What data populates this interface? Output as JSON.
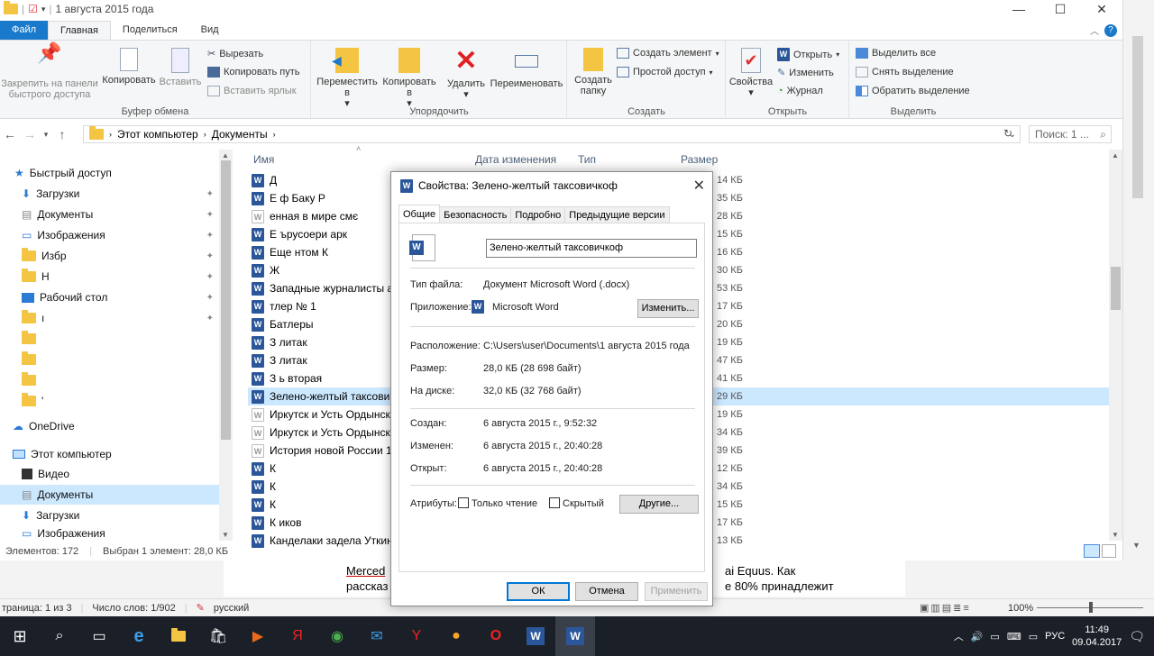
{
  "window": {
    "title": "1 августа 2015  года",
    "minimize": "—",
    "maximize": "☐",
    "close": "✕"
  },
  "ribbon_tabs": [
    {
      "label": "Файл"
    },
    {
      "label": "Главная"
    },
    {
      "label": "Поделиться"
    },
    {
      "label": "Вид"
    }
  ],
  "ribbon": {
    "pin_label": "Закрепить на панели быстрого доступа",
    "copy": "Копировать",
    "paste": "Вставить",
    "cut": "Вырезать",
    "copy_path": "Копировать путь",
    "paste_shortcut": "Вставить ярлык",
    "clipboard_group": "Буфер обмена",
    "move_to": "Переместить в",
    "copy_to": "Копировать в",
    "delete": "Удалить",
    "rename": "Переименовать",
    "organize_group": "Упорядочить",
    "new_folder": "Создать папку",
    "new_item": "Создать элемент",
    "easy_access": "Простой доступ",
    "create_group": "Создать",
    "properties": "Свойства",
    "open": "Открыть",
    "edit": "Изменить",
    "history": "Журнал",
    "open_group": "Открыть",
    "select_all": "Выделить все",
    "select_none": "Снять выделение",
    "invert_selection": "Обратить выделение",
    "select_group": "Выделить"
  },
  "address": {
    "path": [
      "Этот компьютер",
      "Документы"
    ],
    "search_placeholder": "Поиск: 1 ..."
  },
  "nav": {
    "quick_access": "Быстрый доступ",
    "items": [
      {
        "label": "Загрузки"
      },
      {
        "label": "Документы"
      },
      {
        "label": "Изображения"
      },
      {
        "label": "Избр"
      },
      {
        "label": "Н"
      },
      {
        "label": "Рабочий стол"
      },
      {
        "label": "ı"
      },
      {
        "label": ""
      },
      {
        "label": ""
      },
      {
        "label": ""
      },
      {
        "label": "'"
      }
    ],
    "onedrive": "OneDrive",
    "this_pc": "Этот компьютер",
    "pc_items": [
      {
        "label": "Видео"
      },
      {
        "label": "Документы"
      },
      {
        "label": "Загрузки"
      },
      {
        "label": "Изображения"
      }
    ]
  },
  "columns": {
    "name": "Имя",
    "date": "Дата изменения",
    "type": "Тип",
    "size": "Размер"
  },
  "files": [
    {
      "name": "Д",
      "size": "14 КБ"
    },
    {
      "name": "Е ф Баку Р",
      "size": "35 КБ"
    },
    {
      "name": "енная в мире смє",
      "size": "28 КБ"
    },
    {
      "name": "Е ърусоери арк",
      "size": "15 КБ"
    },
    {
      "name": "Еще нтом К",
      "size": "16 КБ"
    },
    {
      "name": "Ж",
      "size": "30 КБ"
    },
    {
      "name": "Западные журналисты ак",
      "size": "53 КБ"
    },
    {
      "name": "тлер № 1",
      "size": "17 КБ"
    },
    {
      "name": "Батлеры",
      "size": "20 КБ"
    },
    {
      "name": "З литак",
      "size": "19 КБ"
    },
    {
      "name": "З литак",
      "size": "47 КБ"
    },
    {
      "name": "З ь вторая",
      "size": "41 КБ"
    },
    {
      "name": "Зелено-желтый таксови",
      "size": "29 КБ"
    },
    {
      "name": "Иркутск и Усть Ордынск",
      "size": "19 КБ"
    },
    {
      "name": "Иркутск и Усть Ордынск",
      "size": "34 КБ"
    },
    {
      "name": "История новой России 1",
      "size": "39 КБ"
    },
    {
      "name": "К",
      "size": "12 КБ"
    },
    {
      "name": "К",
      "size": "34 КБ"
    },
    {
      "name": "К",
      "size": "15 КБ"
    },
    {
      "name": "К иков",
      "size": "17 КБ"
    },
    {
      "name": "Канделаки задела Уткина",
      "size": "13 КБ"
    }
  ],
  "status": {
    "count": "Элементов: 172",
    "selected": "Выбран 1 элемент: 28,0 КБ"
  },
  "word": {
    "line1_a": "Merced",
    "line1_b": "ai Equus. Как",
    "line2_a": "рассказ",
    "line2_b": "е 80% принадлежит",
    "page": "траница: 1 из 3",
    "words": "Число слов: 1/902",
    "lang": "русский",
    "zoom": "100%"
  },
  "dialog": {
    "title": "Свойства: Зелено-желтый  таксовичкоф",
    "tabs": [
      {
        "label": "Общие"
      },
      {
        "label": "Безопасность"
      },
      {
        "label": "Подробно"
      },
      {
        "label": "Предыдущие версии"
      }
    ],
    "filename": "Зелено-желтый  таксовичкоф",
    "type_label": "Тип файла:",
    "type_value": "Документ Microsoft Word (.docx)",
    "app_label": "Приложение:",
    "app_value": "Microsoft Word",
    "change_btn": "Изменить...",
    "location_label": "Расположение:",
    "location_value": "C:\\Users\\user\\Documents\\1 августа 2015  года",
    "size_label": "Размер:",
    "size_value": "28,0 КБ (28 698 байт)",
    "disk_label": "На диске:",
    "disk_value": "32,0 КБ (32 768 байт)",
    "created_label": "Создан:",
    "created_value": "6 августа 2015 г., 9:52:32",
    "modified_label": "Изменен:",
    "modified_value": "6 августа 2015 г., 20:40:28",
    "opened_label": "Открыт:",
    "opened_value": "6 августа 2015 г., 20:40:28",
    "attr_label": "Атрибуты:",
    "readonly": "Только чтение",
    "hidden": "Скрытый",
    "other_btn": "Другие...",
    "ok": "ОК",
    "cancel": "Отмена",
    "apply": "Применить"
  },
  "taskbar": {
    "lang": "РУС",
    "time": "11:49",
    "date": "09.04.2017"
  }
}
